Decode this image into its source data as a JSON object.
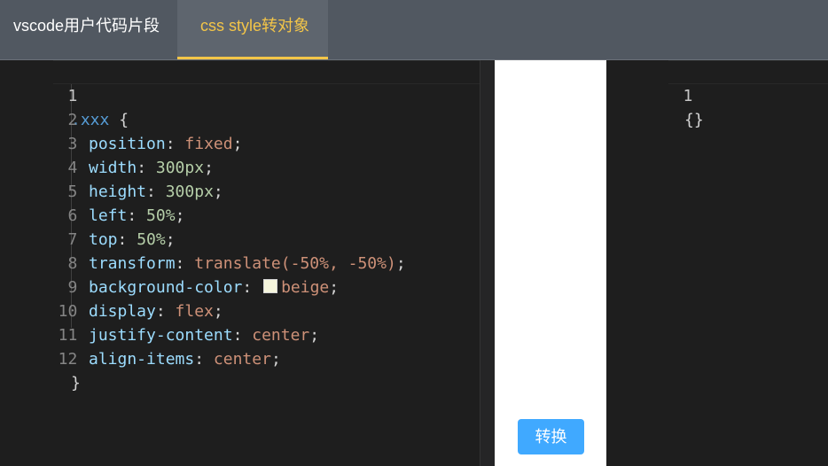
{
  "tabs": [
    {
      "label": "vscode用户代码片段",
      "active": false
    },
    {
      "label": "css style转对象",
      "active": true
    }
  ],
  "colors": {
    "accent": "#f3c548",
    "button": "#40a9ff",
    "swatch": "#f5f5dc"
  },
  "input_editor": {
    "line_numbers": [
      "1",
      "2",
      "3",
      "4",
      "5",
      "6",
      "7",
      "8",
      "9",
      "10",
      "11",
      "12"
    ],
    "lines": [
      {
        "sel": ".xxx",
        "brace": " {"
      },
      {
        "prop": "position",
        "value": "fixed"
      },
      {
        "prop": "width",
        "value": "300px"
      },
      {
        "prop": "height",
        "value": "300px"
      },
      {
        "prop": "left",
        "value": "50%"
      },
      {
        "prop": "top",
        "value": "50%"
      },
      {
        "prop": "transform",
        "value": "translate(-50%, -50%)"
      },
      {
        "prop": "background-color",
        "value": "beige"
      },
      {
        "prop": "display",
        "value": "flex"
      },
      {
        "prop": "justify-content",
        "value": "center"
      },
      {
        "prop": "align-items",
        "value": "center"
      },
      {
        "brace": "}"
      }
    ]
  },
  "convert_button": {
    "label": "转换"
  },
  "output_editor": {
    "line_numbers": [
      "1"
    ],
    "lines": [
      "{}"
    ]
  }
}
